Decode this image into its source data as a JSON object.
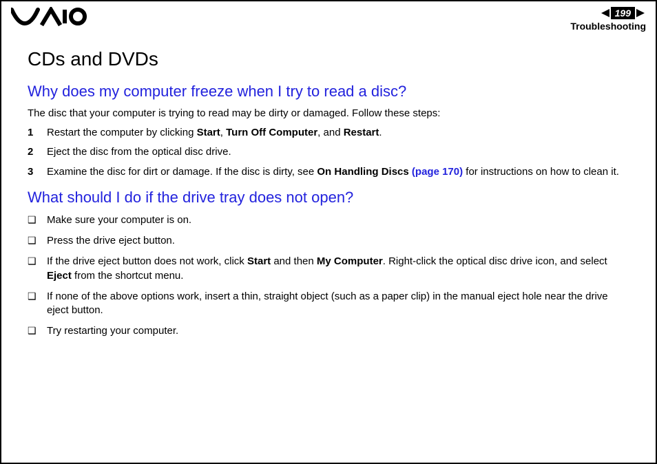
{
  "header": {
    "page_number": "199",
    "section": "Troubleshooting"
  },
  "title": "CDs and DVDs",
  "q1": {
    "heading": "Why does my computer freeze when I try to read a disc?",
    "intro": "The disc that your computer is trying to read may be dirty or damaged. Follow these steps:",
    "steps": {
      "s1_a": "Restart the computer by clicking ",
      "s1_b1": "Start",
      "s1_c": ", ",
      "s1_b2": "Turn Off Computer",
      "s1_d": ", and ",
      "s1_b3": "Restart",
      "s1_e": ".",
      "s2": "Eject the disc from the optical disc drive.",
      "s3_a": "Examine the disc for dirt or damage. If the disc is dirty, see ",
      "s3_b": "On Handling Discs ",
      "s3_link": "(page 170)",
      "s3_c": " for instructions on how to clean it."
    }
  },
  "q2": {
    "heading": "What should I do if the drive tray does not open?",
    "items": {
      "i1": "Make sure your computer is on.",
      "i2": "Press the drive eject button.",
      "i3_a": "If the drive eject button does not work, click ",
      "i3_b1": "Start",
      "i3_b": " and then ",
      "i3_b2": "My Computer",
      "i3_c": ". Right-click the optical disc drive icon, and select ",
      "i3_b3": "Eject",
      "i3_d": " from the shortcut menu.",
      "i4": "If none of the above options work, insert a thin, straight object (such as a paper clip) in the manual eject hole near the drive eject button.",
      "i5": "Try restarting your computer."
    }
  }
}
